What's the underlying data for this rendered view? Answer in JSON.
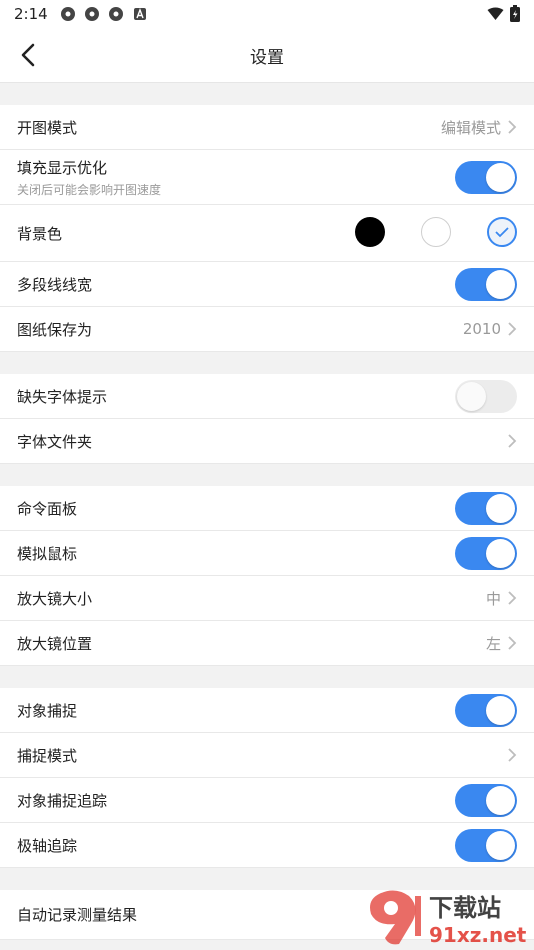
{
  "status": {
    "time": "2:14"
  },
  "header": {
    "title": "设置"
  },
  "sections": {
    "display": {
      "open_mode": {
        "label": "开图模式",
        "value": "编辑模式"
      },
      "fill_opt": {
        "label": "填充显示优化",
        "sub": "关闭后可能会影响开图速度",
        "on": true
      },
      "bg_color": {
        "label": "背景色",
        "options": [
          "#000000",
          "#ffffff",
          "#eef3fa"
        ],
        "selected": 2
      },
      "polyline_width": {
        "label": "多段线线宽",
        "on": true
      },
      "save_as": {
        "label": "图纸保存为",
        "value": "2010"
      }
    },
    "font": {
      "missing_font": {
        "label": "缺失字体提示",
        "on": false
      },
      "font_folder": {
        "label": "字体文件夹"
      }
    },
    "input": {
      "cmd_panel": {
        "label": "命令面板",
        "on": true
      },
      "sim_mouse": {
        "label": "模拟鼠标",
        "on": true
      },
      "magnifier_size": {
        "label": "放大镜大小",
        "value": "中"
      },
      "magnifier_pos": {
        "label": "放大镜位置",
        "value": "左"
      }
    },
    "snap": {
      "obj_snap": {
        "label": "对象捕捉",
        "on": true
      },
      "snap_mode": {
        "label": "捕捉模式"
      },
      "snap_track": {
        "label": "对象捕捉追踪",
        "on": true
      },
      "polar_track": {
        "label": "极轴追踪",
        "on": true
      }
    },
    "measure": {
      "auto_record": {
        "label": "自动记录测量结果"
      }
    }
  },
  "watermark": {
    "brand": "下载站",
    "domain": "91xz.net",
    "accent": "#e0342b"
  },
  "colors": {
    "accent": "#3a88f0"
  }
}
